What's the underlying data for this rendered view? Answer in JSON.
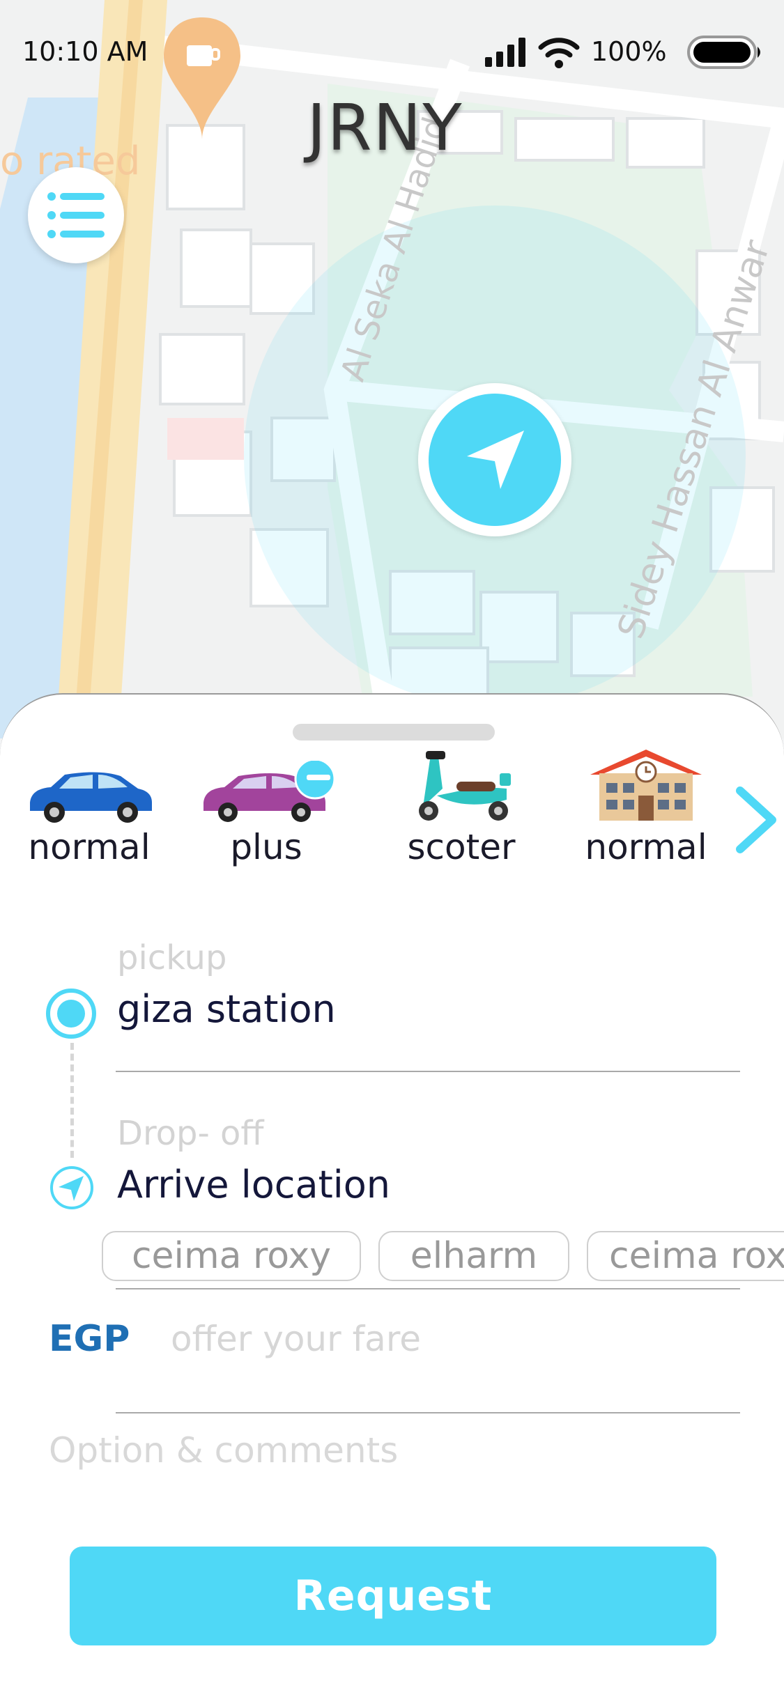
{
  "status": {
    "time": "10:10 AM",
    "battery": "100%"
  },
  "app": {
    "title": "JRNY"
  },
  "map": {
    "labels": [
      "Al Seka Al Hadid",
      "Sidey Hassan Al Anwar",
      "o rated"
    ],
    "accent": "#4fd8f6"
  },
  "vehicles": [
    {
      "label": "normal",
      "icon": "blue-car-icon"
    },
    {
      "label": "plus",
      "icon": "purple-car-icon"
    },
    {
      "label": "scoter",
      "icon": "scooter-icon"
    },
    {
      "label": "normal",
      "icon": "building-icon"
    }
  ],
  "pickup": {
    "label": "pickup",
    "value": "giza station"
  },
  "dropoff": {
    "label": "Drop- off",
    "value": "Arrive location"
  },
  "suggestions": [
    "ceima roxy",
    "elharm",
    "ceima roxy"
  ],
  "fare": {
    "currency": "EGP",
    "placeholder": "offer your fare"
  },
  "comments": {
    "placeholder": "Option & comments"
  },
  "request": {
    "label": "Request"
  }
}
